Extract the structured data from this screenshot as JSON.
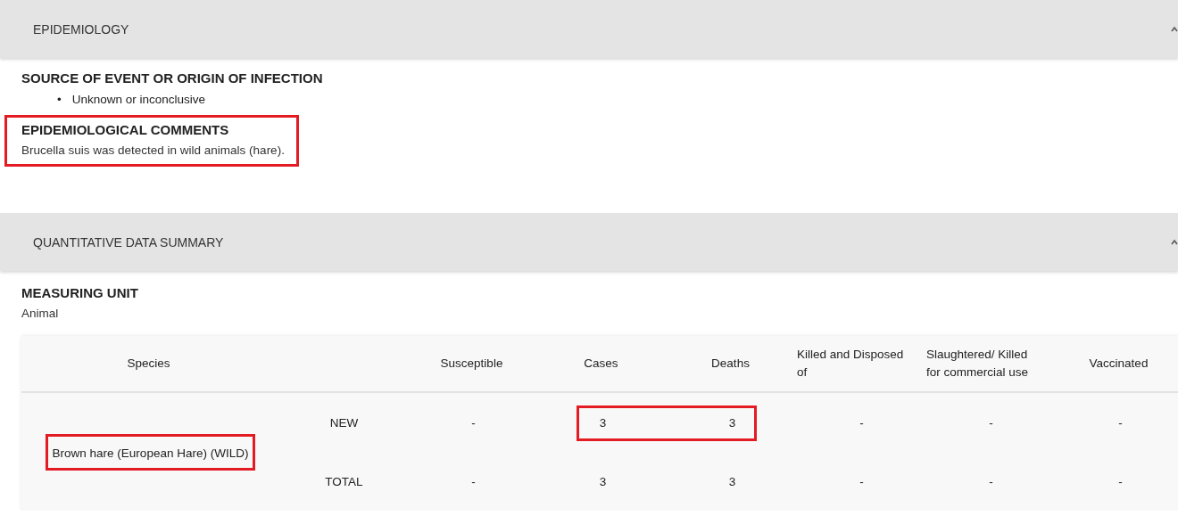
{
  "sections": [
    {
      "title": "EPIDEMIOLOGY",
      "expanded": true,
      "blocks": [
        {
          "kind": "list",
          "heading": "SOURCE OF EVENT OR ORIGIN OF INFECTION",
          "bullet": "•",
          "items": [
            "Unknown or inconclusive"
          ],
          "highlighted": false
        },
        {
          "kind": "text",
          "heading": "EPIDEMIOLOGICAL COMMENTS",
          "text": "Brucella suis was detected in wild animals (hare).",
          "highlighted": true
        }
      ]
    },
    {
      "title": "QUANTITATIVE DATA SUMMARY",
      "expanded": true,
      "blocks": [
        {
          "kind": "text",
          "heading": "MEASURING UNIT",
          "text": "Animal",
          "highlighted": false
        },
        {
          "kind": "table",
          "species_column": "Species",
          "value_columns": [
            "Susceptible",
            "Cases",
            "Deaths",
            "Killed and Disposed of",
            "Slaughtered/ Killed for commercial use",
            "Vaccinated"
          ],
          "rows": [
            {
              "species": "Brown hare (European Hare) (WILD)",
              "highlighted": true,
              "lines": [
                {
                  "label": "NEW",
                  "values": [
                    {
                      "text": "-",
                      "highlighted": false
                    },
                    {
                      "text": "3",
                      "highlighted": true
                    },
                    {
                      "text": "3",
                      "highlighted": true
                    },
                    {
                      "text": "-",
                      "highlighted": false
                    },
                    {
                      "text": "-",
                      "highlighted": false
                    },
                    {
                      "text": "-",
                      "highlighted": false
                    }
                  ]
                },
                {
                  "label": "TOTAL",
                  "values": [
                    {
                      "text": "-",
                      "highlighted": false
                    },
                    {
                      "text": "3",
                      "highlighted": false
                    },
                    {
                      "text": "3",
                      "highlighted": false
                    },
                    {
                      "text": "-",
                      "highlighted": false
                    },
                    {
                      "text": "-",
                      "highlighted": false
                    },
                    {
                      "text": "-",
                      "highlighted": false
                    }
                  ]
                }
              ]
            }
          ]
        }
      ]
    }
  ]
}
